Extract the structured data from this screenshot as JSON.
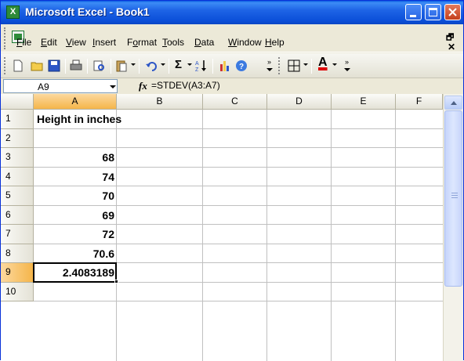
{
  "window": {
    "title": "Microsoft Excel - Book1"
  },
  "menu": {
    "items": [
      {
        "label": "File",
        "u": "F"
      },
      {
        "label": "Edit",
        "u": "E"
      },
      {
        "label": "View",
        "u": "V"
      },
      {
        "label": "Insert",
        "u": "I"
      },
      {
        "label": "Format",
        "u": "o"
      },
      {
        "label": "Tools",
        "u": "T"
      },
      {
        "label": "Data",
        "u": "D"
      },
      {
        "label": "Window",
        "u": "W"
      },
      {
        "label": "Help",
        "u": "H"
      }
    ]
  },
  "toolbar": {
    "sigma": "Σ",
    "font_color_letter": "A"
  },
  "formula_bar": {
    "name_box": "A9",
    "fx": "fx",
    "formula": "=STDEV(A3:A7)"
  },
  "grid": {
    "columns": [
      "A",
      "B",
      "C",
      "D",
      "E",
      "F"
    ],
    "rows": [
      "1",
      "2",
      "3",
      "4",
      "5",
      "6",
      "7",
      "8",
      "9",
      "10"
    ],
    "selected_cell": "A9",
    "cells": {
      "A1": "Height in inches",
      "A3": "68",
      "A4": "74",
      "A5": "70",
      "A6": "69",
      "A7": "72",
      "A8": "70.6",
      "A9": "2.4083189"
    }
  },
  "colors": {
    "title_bar": "#0a5be0",
    "selection_header": "#f5b54a",
    "app_icon": "#2e8b3a"
  }
}
